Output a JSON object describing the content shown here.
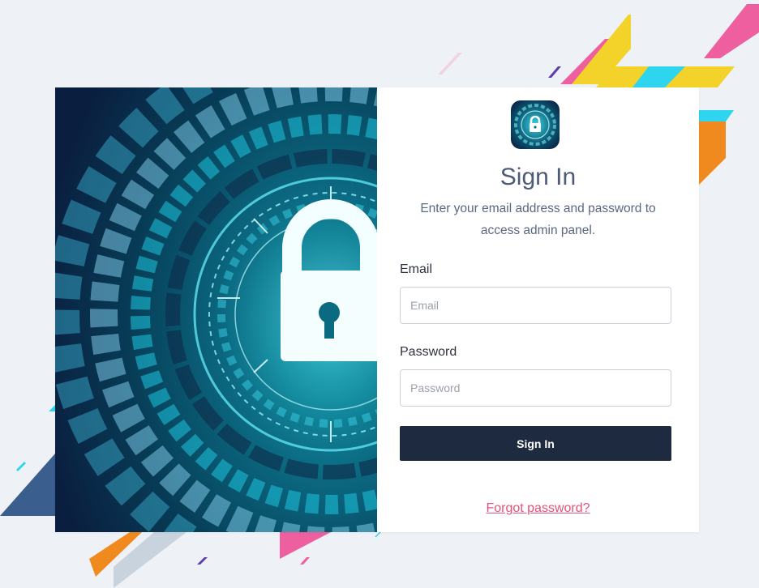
{
  "signin": {
    "title": "Sign In",
    "subtitle": "Enter your email address and password to access admin panel.",
    "email": {
      "label": "Email",
      "placeholder": "Email",
      "value": ""
    },
    "password": {
      "label": "Password",
      "placeholder": "Password",
      "value": ""
    },
    "submit_label": "Sign In",
    "forgot_label": "Forgot password?"
  },
  "icons": {
    "logo": "lock-icon",
    "hero": "padlock-cyber-icon"
  },
  "colors": {
    "background": "#eef2f6",
    "button": "#1e2a40",
    "title": "#4d5a78",
    "link": "#e2537a",
    "stripe_pink": "#ee5fa0",
    "stripe_yellow": "#f3d22a",
    "stripe_orange": "#f08a1e",
    "stripe_cyan": "#2fd4ee",
    "stripe_navy": "#3a5f8f"
  }
}
